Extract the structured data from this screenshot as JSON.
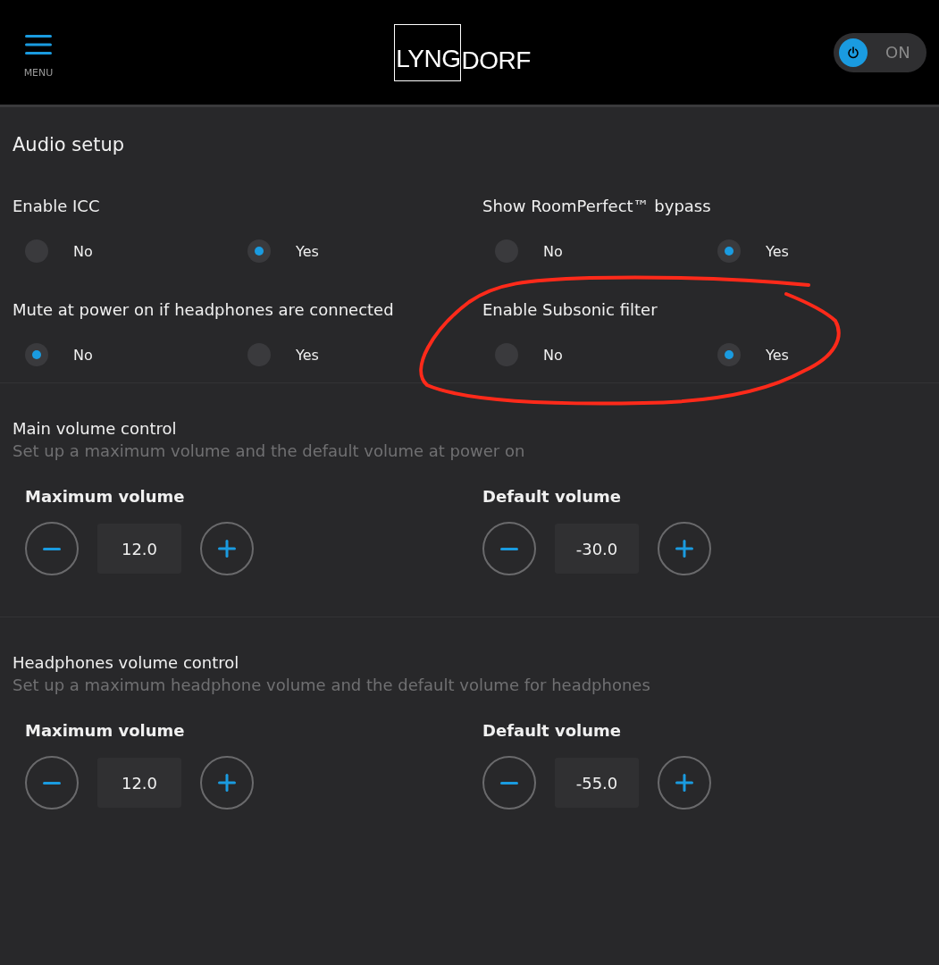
{
  "header": {
    "menu_label": "MENU",
    "logo": {
      "boxed": "LYNG",
      "plain": "DORF"
    },
    "power": {
      "on": true,
      "label": "ON"
    }
  },
  "audio_setup": {
    "title": "Audio setup",
    "settings": [
      {
        "label": "Enable ICC",
        "options": [
          {
            "label": "No",
            "selected": false
          },
          {
            "label": "Yes",
            "selected": true
          }
        ]
      },
      {
        "label": "Show RoomPerfect™ bypass",
        "options": [
          {
            "label": "No",
            "selected": false
          },
          {
            "label": "Yes",
            "selected": true
          }
        ]
      },
      {
        "label": "Mute at power on if headphones are connected",
        "options": [
          {
            "label": "No",
            "selected": true
          },
          {
            "label": "Yes",
            "selected": false
          }
        ]
      },
      {
        "label": "Enable Subsonic filter",
        "options": [
          {
            "label": "No",
            "selected": false
          },
          {
            "label": "Yes",
            "selected": true
          }
        ]
      }
    ]
  },
  "volume_sections": [
    {
      "title": "Main volume control",
      "description": "Set up a maximum volume and the default volume at power on",
      "controls": [
        {
          "label": "Maximum volume",
          "value": "12.0"
        },
        {
          "label": "Default volume",
          "value": "-30.0"
        }
      ]
    },
    {
      "title": "Headphones volume control",
      "description": "Set up a maximum headphone volume and the default volume for headphones",
      "controls": [
        {
          "label": "Maximum volume",
          "value": "12.0"
        },
        {
          "label": "Default volume",
          "value": "-55.0"
        }
      ]
    }
  ],
  "annotation": {
    "kind": "circle"
  }
}
